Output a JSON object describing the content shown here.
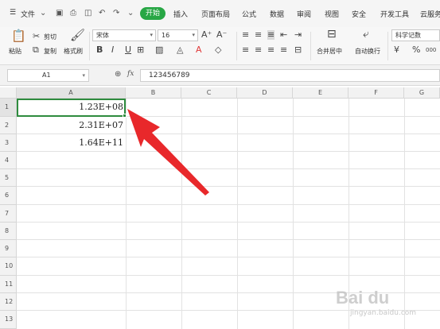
{
  "menu": {
    "hamburger": "☰",
    "file": "文件",
    "tabs": [
      "开始",
      "插入",
      "页面布局",
      "公式",
      "数据",
      "审阅",
      "视图",
      "安全",
      "开发工具",
      "云服务"
    ],
    "active_tab_color": "#28a745"
  },
  "ribbon": {
    "paste": "粘贴",
    "cut": "剪切",
    "copy": "复制",
    "format_painter": "格式刷",
    "font_name": "宋体",
    "font_size": "16",
    "merge_center": "合并居中",
    "wrap_text": "自动换行",
    "number_format": "科学记数",
    "bold": "B",
    "italic": "I",
    "underline": "U",
    "percent": "%",
    "thousands": "000"
  },
  "formula_bar": {
    "name_box": "A1",
    "fx": "fx",
    "value": "123456789"
  },
  "sheet": {
    "columns": [
      "A",
      "B",
      "C",
      "D",
      "E",
      "F",
      "G"
    ],
    "rows": [
      "1",
      "2",
      "3",
      "4",
      "5",
      "6",
      "7",
      "8",
      "9",
      "10",
      "11",
      "12",
      "13"
    ],
    "cells": [
      "1.23E+08",
      "2.31E+07",
      "1.64E+11"
    ],
    "selection_color": "#2e8b3e",
    "arrow_color": "#e8282b"
  },
  "watermark": {
    "logo": "Bai du",
    "sub": "jingyan.baidu.com"
  }
}
